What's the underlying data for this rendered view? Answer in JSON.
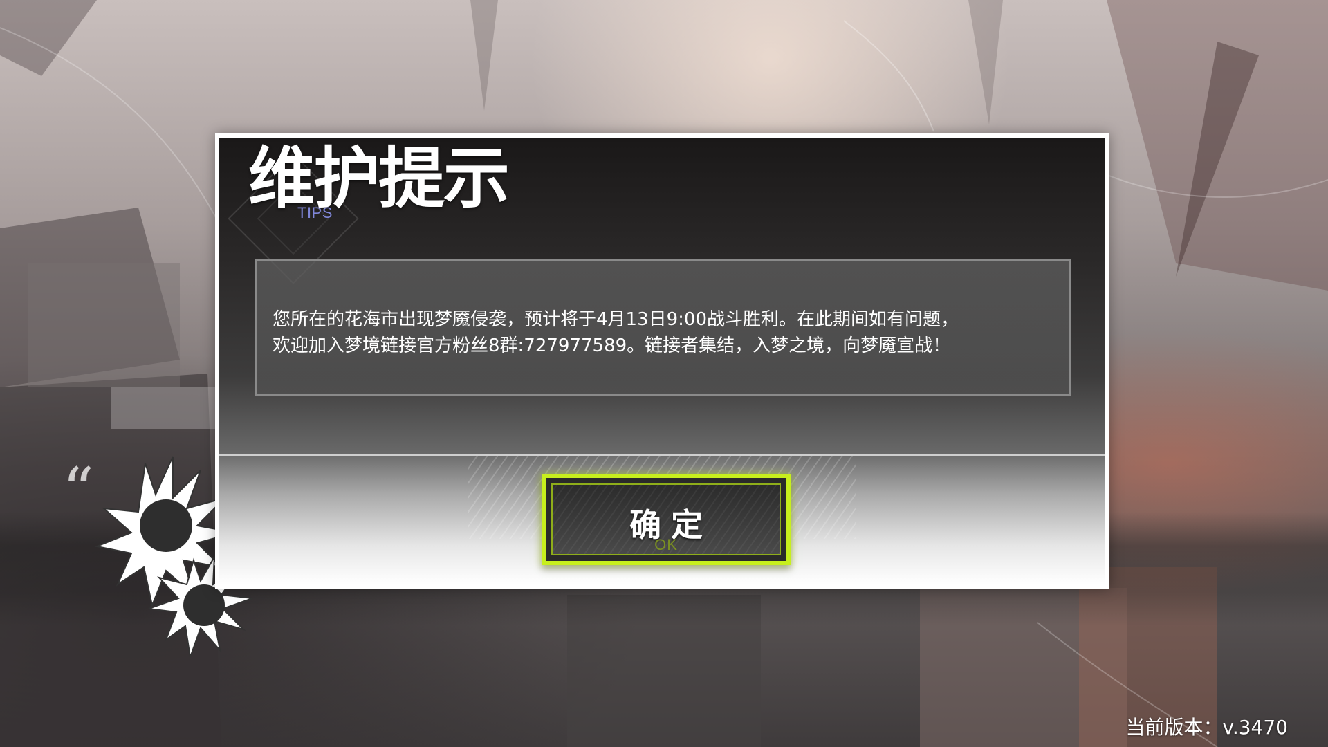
{
  "dialog": {
    "title": "维护提示",
    "subtitle": "TIPS",
    "message": "您所在的花海市出现梦魇侵袭，预计将于4月13日9:00战斗胜利。在此期间如有问题，\n欢迎加入梦境链接官方粉丝8群:727977589。链接者集结，入梦之境，向梦魇宣战！",
    "confirm_button": {
      "label": "确定",
      "sublabel": "OK"
    }
  },
  "footer": {
    "version": "当前版本：v.3470"
  },
  "colors": {
    "button_accent": "#c7ef1d",
    "tips_text": "#7f86d8"
  },
  "icons": {
    "decoration": "quote-burst-icon"
  }
}
